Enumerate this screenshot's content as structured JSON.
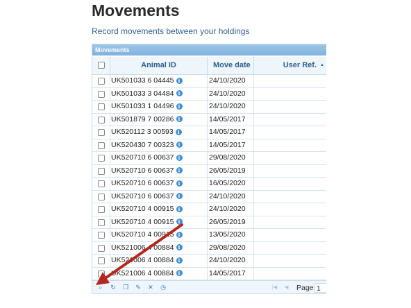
{
  "page": {
    "title": "Movements",
    "subtitle": "Record movements between your holdings"
  },
  "grid": {
    "caption": "Movements",
    "columns": {
      "animal_id": "Animal ID",
      "move_date": "Move date",
      "user_ref": "User Ref."
    },
    "rows": [
      {
        "animal_id": "UK501033 6 04445",
        "move_date": "24/10/2020",
        "user_ref": ""
      },
      {
        "animal_id": "UK501033 3 04484",
        "move_date": "24/10/2020",
        "user_ref": ""
      },
      {
        "animal_id": "UK501033 1 04496",
        "move_date": "24/10/2020",
        "user_ref": ""
      },
      {
        "animal_id": "UK501879 7 00286",
        "move_date": "14/05/2017",
        "user_ref": ""
      },
      {
        "animal_id": "UK520112 3 00593",
        "move_date": "14/05/2017",
        "user_ref": ""
      },
      {
        "animal_id": "UK520430 7 00323",
        "move_date": "14/05/2017",
        "user_ref": ""
      },
      {
        "animal_id": "UK520710 6 00637",
        "move_date": "29/08/2020",
        "user_ref": ""
      },
      {
        "animal_id": "UK520710 6 00637",
        "move_date": "26/05/2019",
        "user_ref": ""
      },
      {
        "animal_id": "UK520710 6 00637",
        "move_date": "16/05/2020",
        "user_ref": ""
      },
      {
        "animal_id": "UK520710 6 00637",
        "move_date": "24/10/2020",
        "user_ref": ""
      },
      {
        "animal_id": "UK520710 4 00915",
        "move_date": "24/10/2020",
        "user_ref": ""
      },
      {
        "animal_id": "UK520710 4 00915",
        "move_date": "26/05/2019",
        "user_ref": ""
      },
      {
        "animal_id": "UK520710 4 00915",
        "move_date": "13/05/2020",
        "user_ref": ""
      },
      {
        "animal_id": "UK521006 4 00884",
        "move_date": "29/08/2020",
        "user_ref": ""
      },
      {
        "animal_id": "UK521006 4 00884",
        "move_date": "24/10/2020",
        "user_ref": ""
      },
      {
        "animal_id": "UK521006 4 00884",
        "move_date": "14/05/2017",
        "user_ref": ""
      }
    ],
    "info_glyph": "i",
    "sort_glyph": "▲",
    "toolbar": {
      "icons": [
        "search-icon",
        "refresh-icon",
        "document-icon",
        "edit-icon",
        "delete-icon",
        "clock-icon"
      ],
      "glyphs": [
        "⌕",
        "↻",
        "❐",
        "✎",
        "✕",
        "◷"
      ]
    },
    "pager": {
      "first_glyph": "|◀",
      "prev_glyph": "◀",
      "page_label": "Page",
      "page_value": "1"
    }
  },
  "annotation": {
    "arrow_color": "#b3281e"
  }
}
